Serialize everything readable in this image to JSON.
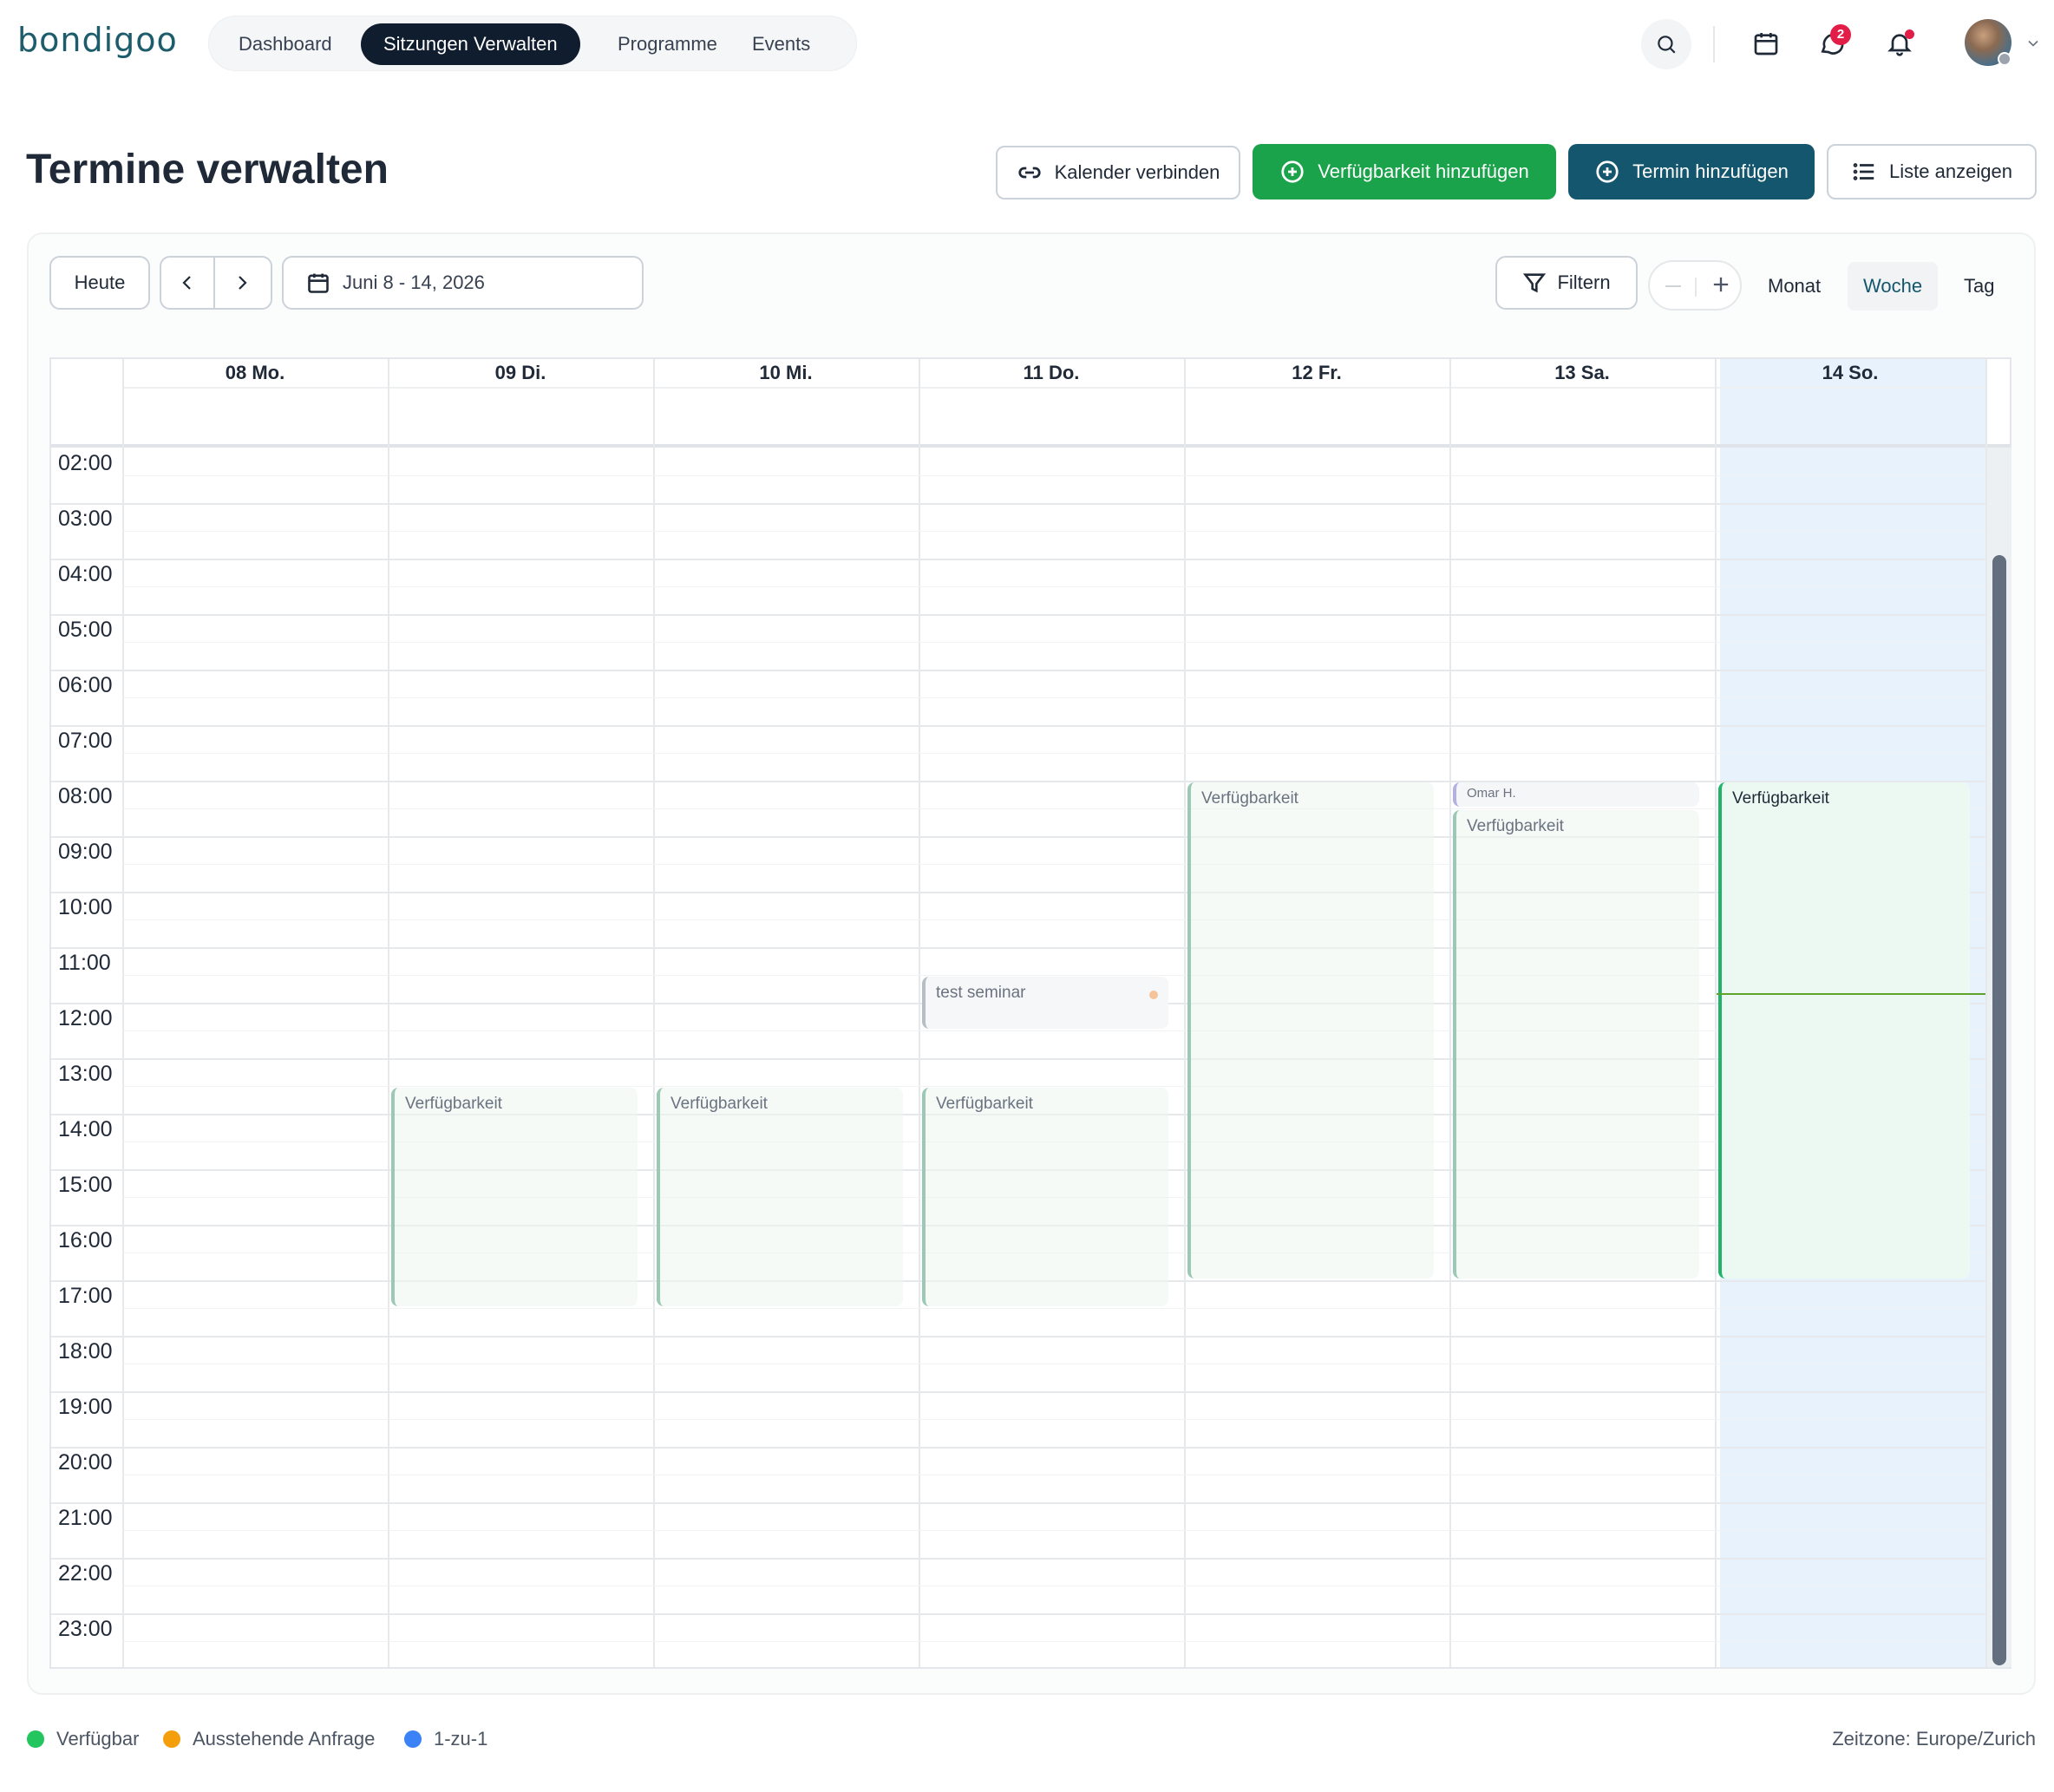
{
  "app": {
    "logo": "bondigoo"
  },
  "nav": {
    "items": [
      {
        "label": "Dashboard"
      },
      {
        "label": "Sitzungen Verwalten",
        "active": true
      },
      {
        "label": "Programme"
      },
      {
        "label": "Events"
      }
    ],
    "message_badge_count": "2"
  },
  "header": {
    "title": "Termine verwalten",
    "connect_calendar": "Kalender verbinden",
    "add_availability": "Verfügbarkeit hinzufügen",
    "add_appointment": "Termin hinzufügen",
    "show_list": "Liste anzeigen"
  },
  "toolbar": {
    "today": "Heute",
    "date_range": "Juni 8 - 14, 2026",
    "filter": "Filtern",
    "views": [
      {
        "label": "Monat"
      },
      {
        "label": "Woche",
        "active": true
      },
      {
        "label": "Tag"
      }
    ]
  },
  "calendar": {
    "days": [
      {
        "label": "08 Mo."
      },
      {
        "label": "09 Di."
      },
      {
        "label": "10 Mi."
      },
      {
        "label": "11 Do."
      },
      {
        "label": "12 Fr."
      },
      {
        "label": "13 Sa."
      },
      {
        "label": "14 So.",
        "today": true
      }
    ],
    "hours": [
      "02:00",
      "03:00",
      "04:00",
      "05:00",
      "06:00",
      "07:00",
      "08:00",
      "09:00",
      "10:00",
      "11:00",
      "12:00",
      "13:00",
      "14:00",
      "15:00",
      "16:00",
      "17:00",
      "18:00",
      "19:00",
      "20:00",
      "21:00",
      "22:00",
      "23:00"
    ],
    "events": [
      {
        "day": "09 Di.",
        "title": "Verfügbarkeit",
        "start": "13:30",
        "end": "17:30"
      },
      {
        "day": "10 Mi.",
        "title": "Verfügbarkeit",
        "start": "13:30",
        "end": "17:30"
      },
      {
        "day": "11 Do.",
        "title": "test seminar",
        "start": "11:30",
        "end": "12:30"
      },
      {
        "day": "11 Do.",
        "title": "Verfügbarkeit",
        "start": "13:30",
        "end": "17:30"
      },
      {
        "day": "12 Fr.",
        "title": "Verfügbarkeit",
        "start": "08:00",
        "end": "17:00"
      },
      {
        "day": "13 Sa.",
        "title": "Omar H.",
        "start": "08:00",
        "end": "08:30"
      },
      {
        "day": "13 Sa.",
        "title": "Verfügbarkeit",
        "start": "08:30",
        "end": "17:00"
      },
      {
        "day": "14 So.",
        "title": "Verfügbarkeit",
        "start": "08:00",
        "end": "17:00"
      }
    ],
    "current_time": "11:50"
  },
  "legend": [
    {
      "label": "Verfügbar",
      "color": "#22c55e"
    },
    {
      "label": "Ausstehende Anfrage",
      "color": "#f59e0b"
    },
    {
      "label": "1-zu-1",
      "color": "#3b82f6"
    }
  ],
  "timezone": "Zeitzone: Europe/Zurich",
  "colors": {
    "brand": "#1d5d6b",
    "green": "#1aa34a",
    "teal": "#14566e",
    "today_column": "#e8f2fc"
  }
}
